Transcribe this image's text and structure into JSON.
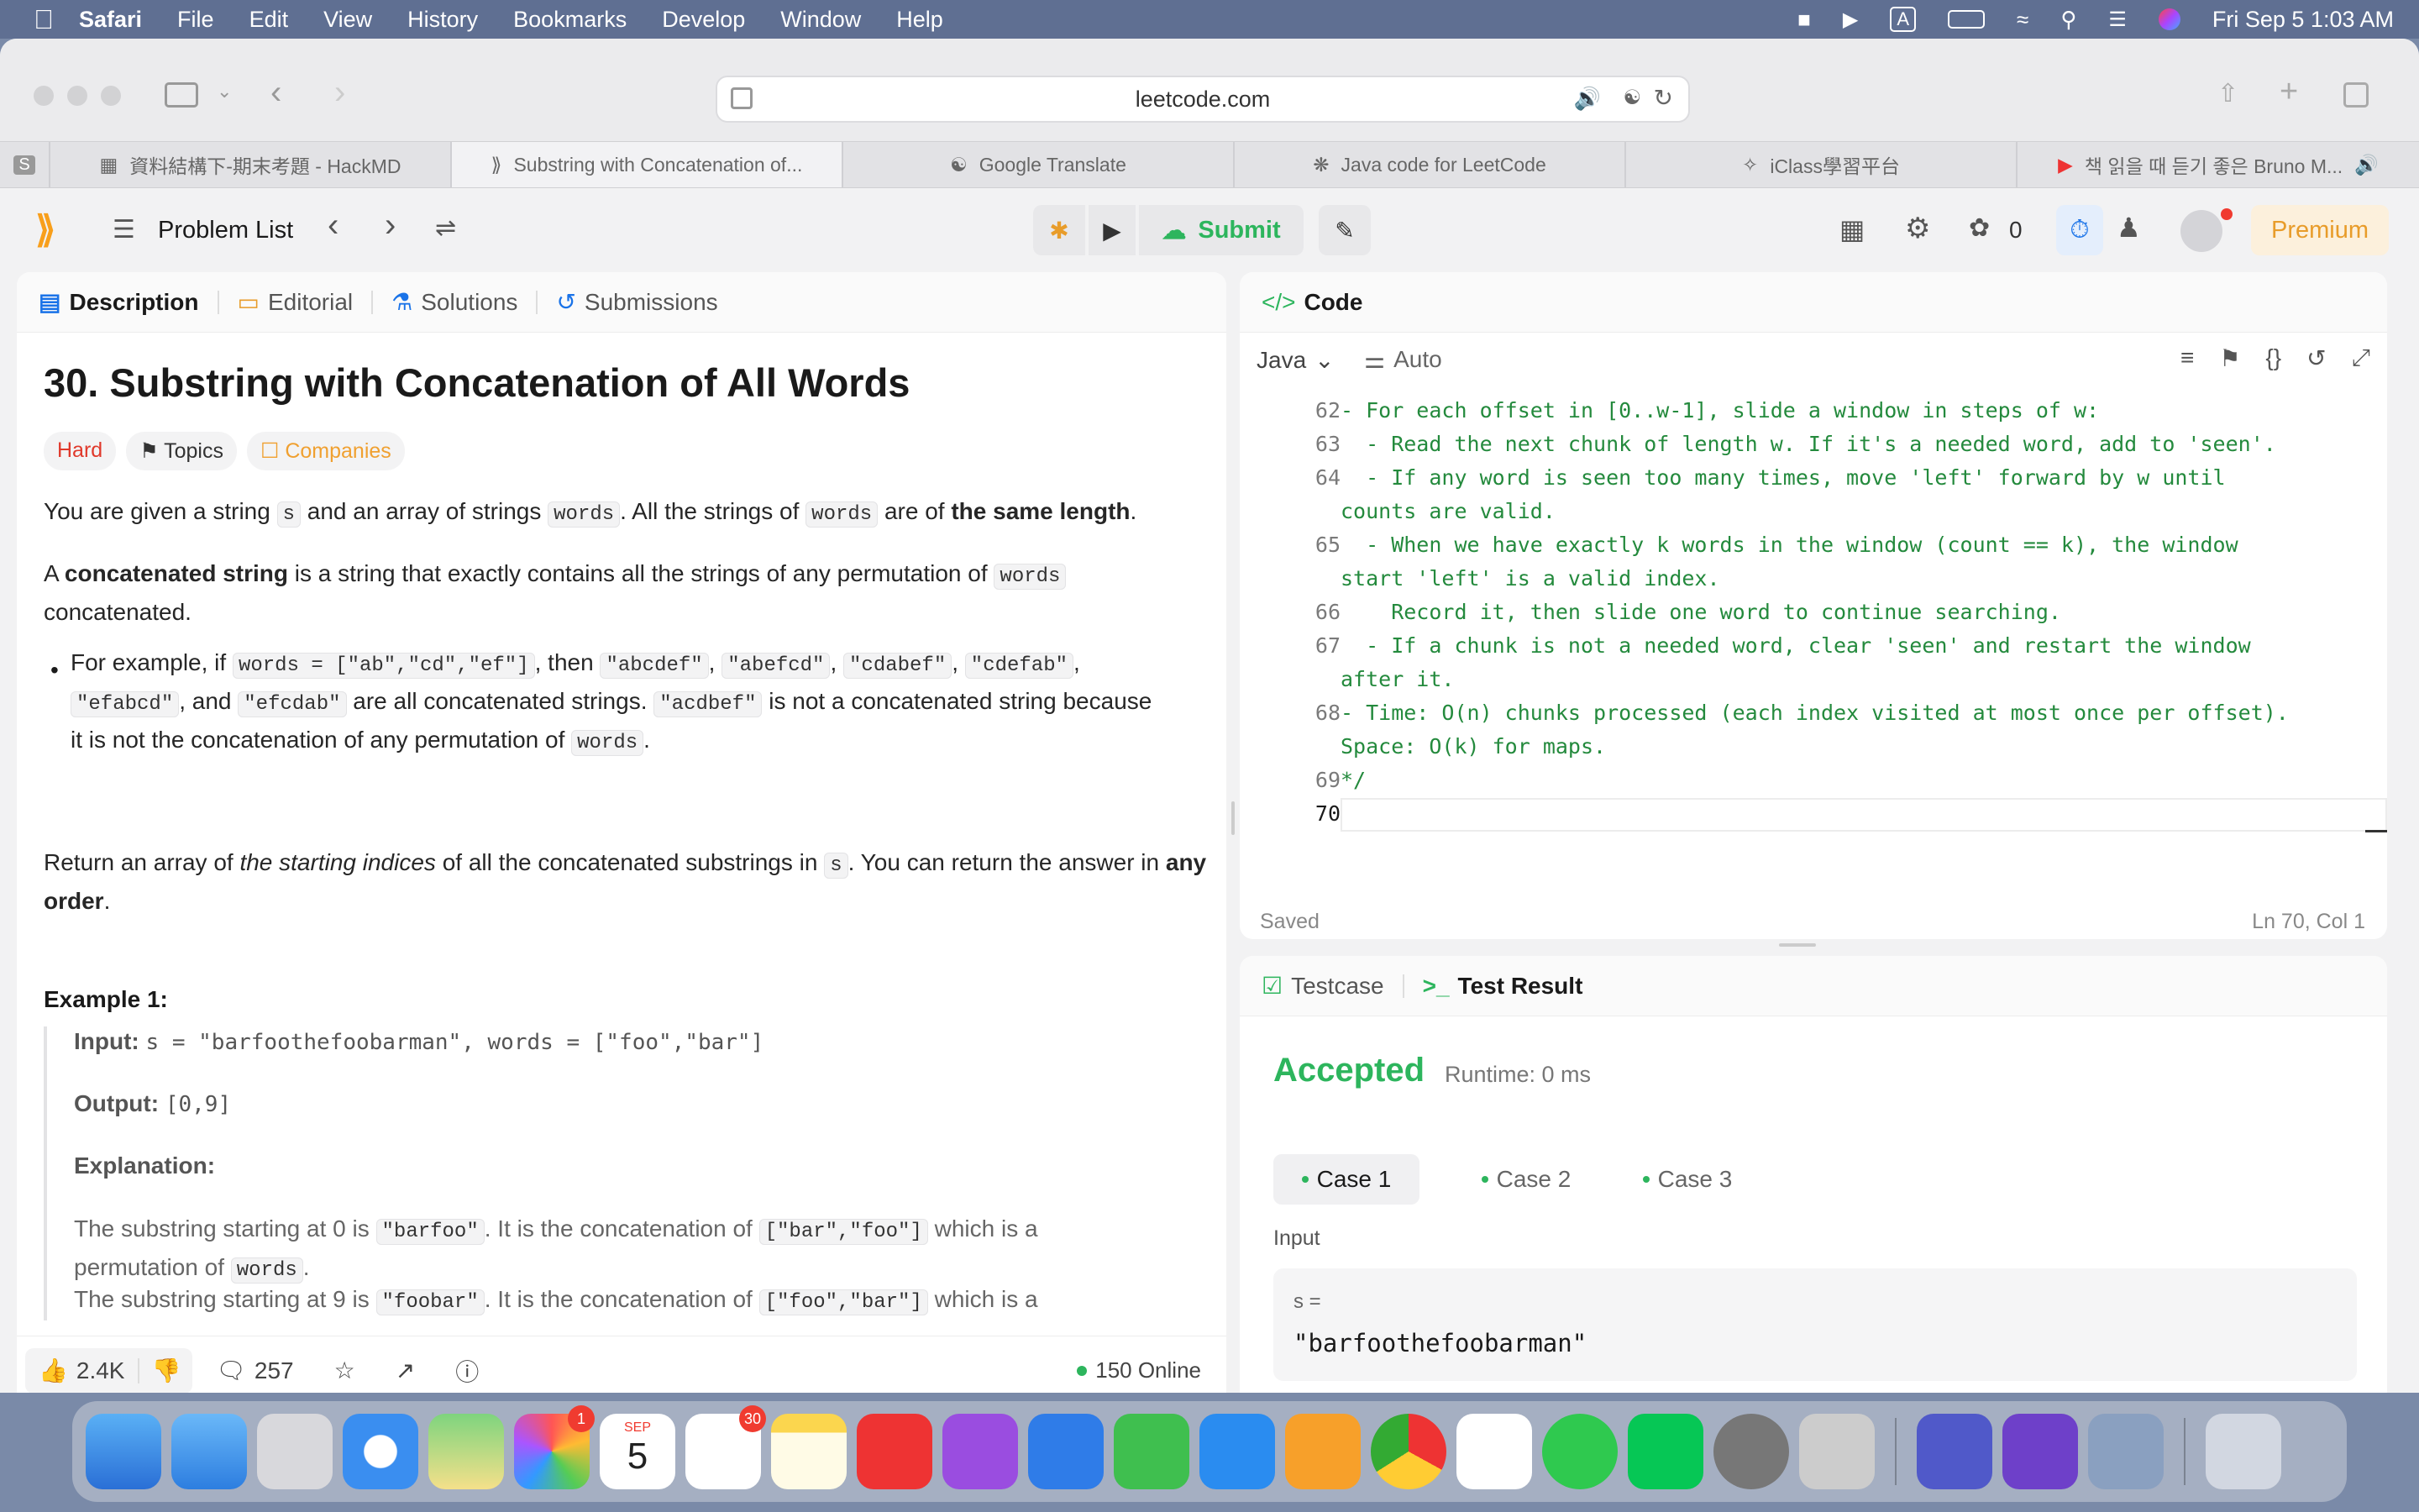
{
  "menubar": {
    "app": "Safari",
    "items": [
      "File",
      "Edit",
      "View",
      "History",
      "Bookmarks",
      "Develop",
      "Window",
      "Help"
    ],
    "datetime": "Fri Sep 5  1:03 AM"
  },
  "browser": {
    "url": "leetcode.com",
    "tabs": [
      {
        "label": "資料結構下-期末考題 - HackMD"
      },
      {
        "label": "Substring with Concatenation of..."
      },
      {
        "label": "Google Translate"
      },
      {
        "label": "Java code for LeetCode"
      },
      {
        "label": "iClass學習平台"
      },
      {
        "label": "책 읽을 때 듣기 좋은 Bruno M..."
      }
    ]
  },
  "lc": {
    "problem_list": "Problem List",
    "submit": "Submit",
    "streak": "0",
    "premium": "Premium"
  },
  "desc_tabs": [
    "Description",
    "Editorial",
    "Solutions",
    "Submissions"
  ],
  "problem": {
    "title": "30. Substring with Concatenation of All Words",
    "difficulty": "Hard",
    "topics": "Topics",
    "companies": "Companies",
    "p1": {
      "a": "You are given a string ",
      "s": "s",
      "b": " and an array of strings ",
      "w": "words",
      "c": ". All the strings of ",
      "w2": "words",
      "d": " are of ",
      "e": "the same length",
      "f": "."
    },
    "p2": {
      "a": "A ",
      "b": "concatenated string",
      "c": " is a string that exactly contains all the strings of any permutation of ",
      "w": "words",
      "d": "concatenated."
    },
    "bullet": {
      "a": "For example, if ",
      "c1": "words = [\"ab\",\"cd\",\"ef\"]",
      "b": ", then ",
      "c2": "\"abcdef\"",
      "c3": "\"abefcd\"",
      "c4": "\"cdabef\"",
      "c5": "\"cdefab\"",
      "c6": "\"efabcd\"",
      "and": ", and ",
      "c7": "\"efcdab\"",
      "d": " are all concatenated strings. ",
      "c8": "\"acdbef\"",
      "e": " is not a concatenated string because it is not the concatenation of any permutation of ",
      "w": "words",
      "f": "."
    },
    "p3": {
      "a": "Return an array of ",
      "i": "the starting indices",
      "b": " of all the concatenated substrings in ",
      "s": "s",
      "c": ". You can return the answer in ",
      "bo": "any order",
      "d": "."
    },
    "example_title": "Example 1:",
    "input_label": "Input:",
    "input_value": "s = \"barfoothefoobarman\", words = [\"foo\",\"bar\"]",
    "output_label": "Output:",
    "output_value": "[0,9]",
    "expl_label": "Explanation:",
    "e1": {
      "a": "The substring starting at 0 is ",
      "c1": "\"barfoo\"",
      "b": ". It is the concatenation of ",
      "c2": "[\"bar\",\"foo\"]",
      "c": " which is a permutation of ",
      "w": "words",
      "d": "."
    },
    "e2": {
      "a": "The substring starting at 9 is ",
      "c1": "\"foobar\"",
      "b": ". It is the concatenation of ",
      "c2": "[\"foo\",\"bar\"]",
      "c": " which is a"
    }
  },
  "footer": {
    "likes": "2.4K",
    "comments": "257",
    "online": "150 Online"
  },
  "code": {
    "title": "Code",
    "lang": "Java",
    "auto": "Auto",
    "saved": "Saved",
    "pos": "Ln 70, Col 1",
    "lines": [
      {
        "n": "62",
        "t": "- For each offset in [0..w-1], slide a window in steps of w:"
      },
      {
        "n": "63",
        "t": "  - Read the next chunk of length w. If it's a needed word, add to 'seen'."
      },
      {
        "n": "64",
        "t": "  - If any word is seen too many times, move 'left' forward by w until"
      },
      {
        "n": "",
        "t": "counts are valid."
      },
      {
        "n": "65",
        "t": "  - When we have exactly k words in the window (count == k), the window"
      },
      {
        "n": "",
        "t": "start 'left' is a valid index."
      },
      {
        "n": "66",
        "t": "    Record it, then slide one word to continue searching."
      },
      {
        "n": "67",
        "t": "  - If a chunk is not a needed word, clear 'seen' and restart the window"
      },
      {
        "n": "",
        "t": "after it."
      },
      {
        "n": "68",
        "t": "- Time: O(n) chunks processed (each index visited at most once per offset)."
      },
      {
        "n": "",
        "t": "Space: O(k) for maps."
      },
      {
        "n": "69",
        "t": "*/"
      },
      {
        "n": "70",
        "t": ""
      }
    ]
  },
  "result": {
    "testcase": "Testcase",
    "test_result": "Test Result",
    "status": "Accepted",
    "runtime": "Runtime: 0 ms",
    "cases": [
      "Case 1",
      "Case 2",
      "Case 3"
    ],
    "input_label": "Input",
    "var": "s =",
    "value": "\"barfoothefoobarman\""
  },
  "dock": {
    "calendar_month": "SEP",
    "calendar_day": "5",
    "photos_badge": "1",
    "reminders_badge": "30"
  },
  "colors": {
    "accepted": "#2db55d",
    "hard": "#e0392b",
    "companies": "#f0a030",
    "code_comment": "#248a3d"
  }
}
